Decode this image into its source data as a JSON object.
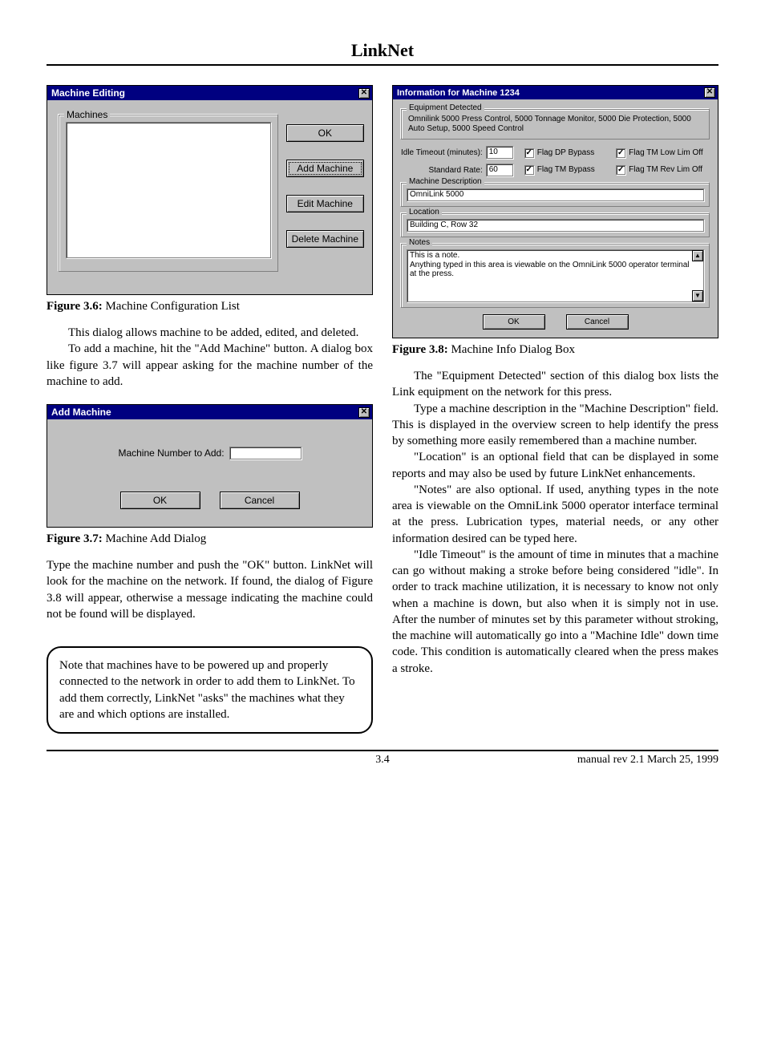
{
  "doc": {
    "title": "LinkNet",
    "page_number": "3.4",
    "footer_right": "manual rev 2.1     March 25, 1999"
  },
  "fig36": {
    "title": "Machine Editing",
    "group": "Machines",
    "buttons": {
      "ok": "OK",
      "add": "Add Machine",
      "edit": "Edit Machine",
      "del": "Delete Machine"
    },
    "close": "✕",
    "caption_b": "Figure 3.6:",
    "caption": " Machine Configuration List"
  },
  "left_paras": {
    "p1": "This dialog allows machine to be added, edited, and deleted.",
    "p2": "To add a machine, hit the \"Add Machine\" button.  A dialog box like figure 3.7 will appear asking for the machine number of the machine to add."
  },
  "fig37": {
    "title": "Add Machine",
    "close": "✕",
    "label": "Machine Number to Add:",
    "value": "",
    "ok": "OK",
    "cancel": "Cancel",
    "caption_b": "Figure 3.7:",
    "caption": " Machine Add Dialog"
  },
  "left_para3": "Type the machine number and push the \"OK\" button.  LinkNet will look for the machine on the network.  If found, the dialog of Figure 3.8 will appear, otherwise a message indicating the machine could not be found will be displayed.",
  "note": "Note that machines have to be powered up and properly connected to the network in order to add them to LinkNet.  To add them correctly, LinkNet \"asks\" the machines what they are and which options are installed.",
  "fig38": {
    "title": "Information for Machine 1234",
    "close": "✕",
    "equip_legend": "Equipment Detected",
    "equip_text": "Omnilink 5000 Press Control, 5000 Tonnage Monitor, 5000 Die Protection, 5000 Auto Setup, 5000 Speed Control",
    "idle_label": "Idle Timeout (minutes):",
    "idle_value": "10",
    "rate_label": "Standard Rate:",
    "rate_value": "60",
    "chk1": "Flag DP Bypass",
    "chk2": "Flag TM Low Lim Off",
    "chk3": "Flag TM Bypass",
    "chk4": "Flag TM Rev Lim Off",
    "desc_legend": "Machine Description",
    "desc_value": "OmniLink 5000",
    "loc_legend": "Location",
    "loc_value": "Building C, Row 32",
    "notes_legend": "Notes",
    "notes_value": "This is a note.\nAnything typed in this area is viewable on the OmniLink 5000 operator terminal at the press.",
    "ok": "OK",
    "cancel": "Cancel",
    "caption_b": "Figure 3.8:",
    "caption": " Machine Info Dialog Box"
  },
  "right_paras": {
    "p1": "The \"Equipment Detected\" section of this dialog box lists the Link equipment on the network for this press.",
    "p2": "Type a machine description in the \"Machine Description\" field.  This is displayed in the overview screen to help identify the press by something more easily remembered than a machine number.",
    "p3": " \"Location\" is an optional field that can be displayed in some reports and may also be used by future LinkNet enhancements.",
    "p4": "\"Notes\" are also optional.  If used, anything types in the note area is viewable on the OmniLink 5000 operator interface terminal at the press.  Lubrication types, material needs, or any other information desired can be typed here.",
    "p5": "\"Idle Timeout\" is the amount of time in minutes that a machine can go without making a stroke before being considered \"idle\".  In order to track machine utilization, it is necessary to know not only when a machine is down, but also when it is simply not in use.  After the number of minutes set by this parameter without stroking, the machine will automatically go into a \"Machine Idle\" down time code.  This condition is automatically cleared when the press makes a stroke."
  }
}
